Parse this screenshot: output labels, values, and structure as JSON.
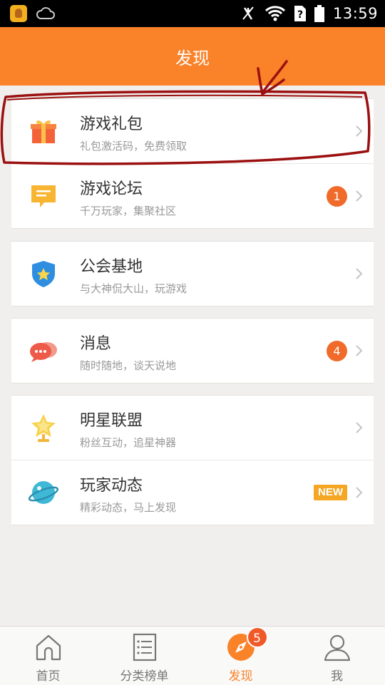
{
  "status_bar": {
    "time": "13:59"
  },
  "header": {
    "title": "发现"
  },
  "groups": [
    {
      "items": [
        {
          "title": "游戏礼包",
          "subtitle": "礼包激活码，免费领取",
          "icon": "gift-icon"
        },
        {
          "title": "游戏论坛",
          "subtitle": "千万玩家，集聚社区",
          "icon": "forum-icon",
          "badge": "1"
        }
      ]
    },
    {
      "items": [
        {
          "title": "公会基地",
          "subtitle": "与大神侃大山，玩游戏",
          "icon": "guild-shield-icon"
        }
      ]
    },
    {
      "items": [
        {
          "title": "消息",
          "subtitle": "随时随地，谈天说地",
          "icon": "message-bubbles-icon",
          "badge": "4"
        }
      ]
    },
    {
      "items": [
        {
          "title": "明星联盟",
          "subtitle": "粉丝互动，追星神器",
          "icon": "star-trophy-icon"
        },
        {
          "title": "玩家动态",
          "subtitle": "精彩动态，马上发现",
          "icon": "planet-icon",
          "badge": "NEW"
        }
      ]
    }
  ],
  "bottom_nav": {
    "items": [
      {
        "label": "首页",
        "icon": "home-icon"
      },
      {
        "label": "分类榜单",
        "icon": "list-icon"
      },
      {
        "label": "发现",
        "icon": "compass-icon",
        "badge": "5",
        "active": true
      },
      {
        "label": "我",
        "icon": "person-icon"
      }
    ]
  },
  "colors": {
    "accent": "#fa8228",
    "badge": "#f06a2a",
    "new_badge": "#f5a623",
    "annotation": "#a01010"
  }
}
